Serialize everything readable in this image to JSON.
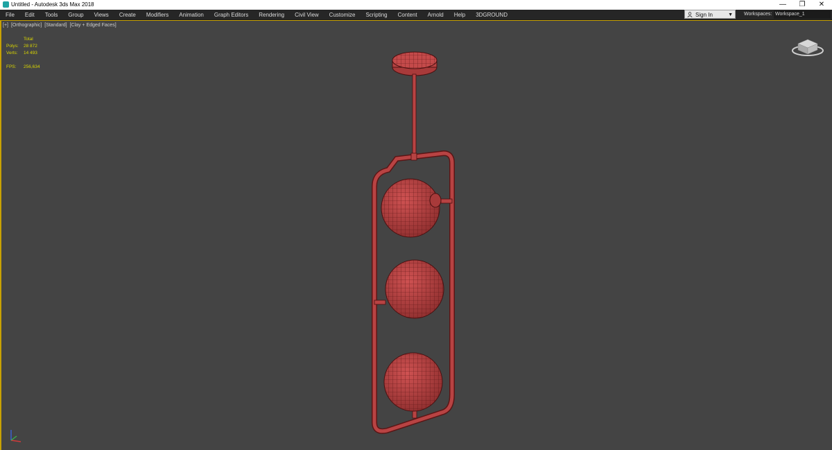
{
  "window": {
    "title": "Untitled - Autodesk 3ds Max 2018",
    "controls": {
      "minimize": "—",
      "restore": "❐",
      "close": "✕"
    }
  },
  "menu": {
    "items": [
      "File",
      "Edit",
      "Tools",
      "Group",
      "Views",
      "Create",
      "Modifiers",
      "Animation",
      "Graph Editors",
      "Rendering",
      "Civil View",
      "Customize",
      "Scripting",
      "Content",
      "Arnold",
      "Help",
      "3DGROUND"
    ]
  },
  "signin": {
    "label": "Sign In",
    "icon": "user-icon",
    "caret": "▼"
  },
  "workspaces": {
    "label": "Workspaces:",
    "value": "Workspace_1"
  },
  "viewport": {
    "label_parts": [
      "[+]",
      "[Orthographic]",
      "[Standard]",
      "[Clay + Edged Faces]"
    ],
    "stats": {
      "header": "Total",
      "polys_label": "Polys:",
      "polys_value": "28 872",
      "verts_label": "Verts:",
      "verts_value": "14 493",
      "fps_label": "FPS:",
      "fps_value": "256,634"
    },
    "colors": {
      "background": "#444444",
      "model": "#b84343",
      "wire": "#5a1515",
      "stats_text": "#d9d500",
      "active_border": "#c8a100"
    }
  }
}
